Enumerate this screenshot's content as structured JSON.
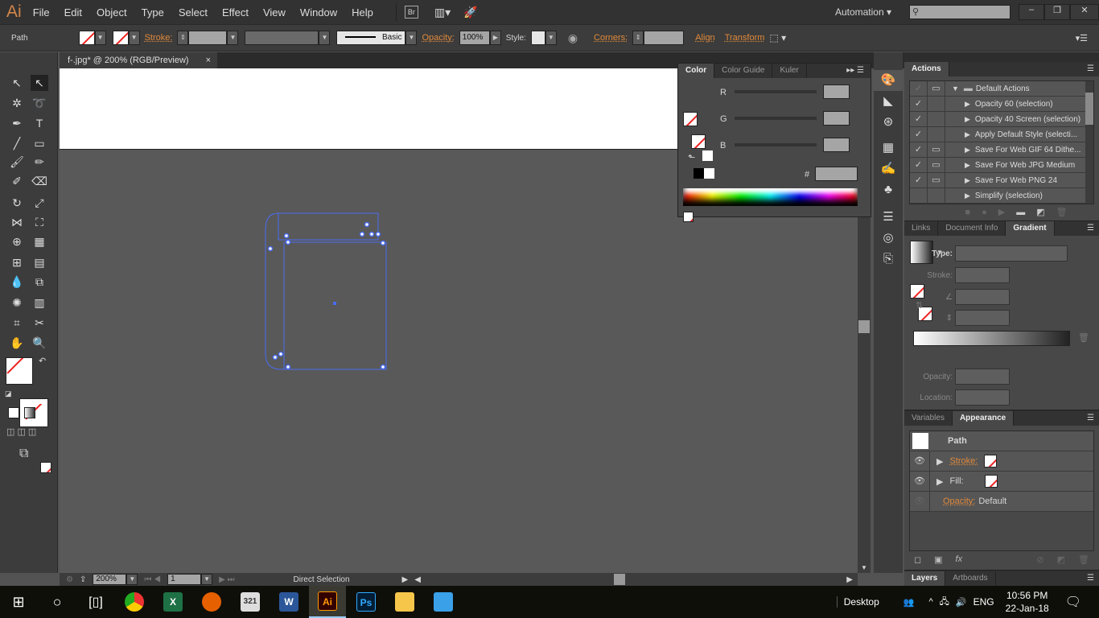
{
  "app": {
    "logo": "Ai"
  },
  "menu": [
    "File",
    "Edit",
    "Object",
    "Type",
    "Select",
    "Effect",
    "View",
    "Window",
    "Help"
  ],
  "bridge": "Br",
  "workspace": "Automation",
  "search": {
    "placeholder": ""
  },
  "control": {
    "selection": "Path",
    "stroke_label": "Stroke:",
    "brush": "Basic",
    "opacity_label": "Opacity:",
    "opacity": "100%",
    "style_label": "Style:",
    "corners_label": "Corners:",
    "align": "Align",
    "transform": "Transform"
  },
  "document": {
    "tab": "f-.jpg* @ 200% (RGB/Preview)",
    "close": "×"
  },
  "color_panel": {
    "tabs": [
      "Color",
      "Color Guide",
      "Kuler"
    ],
    "r": "R",
    "g": "G",
    "b": "B",
    "hash": "#"
  },
  "actions": {
    "tab": "Actions",
    "items": [
      {
        "label": "Default Actions",
        "folder": true
      },
      {
        "label": "Opacity 60 (selection)"
      },
      {
        "label": "Opacity 40 Screen (selection)"
      },
      {
        "label": "Apply Default Style (selecti..."
      },
      {
        "label": "Save For Web GIF 64 Dithe..."
      },
      {
        "label": "Save For Web JPG Medium"
      },
      {
        "label": "Save For Web PNG 24"
      },
      {
        "label": "Simplify (selection)"
      }
    ]
  },
  "gradient": {
    "tabs": [
      "Links",
      "Document Info",
      "Gradient"
    ],
    "type_label": "Type:",
    "stroke_label": "Stroke:",
    "opacity_label": "Opacity:",
    "location_label": "Location:"
  },
  "appearance": {
    "tabs": [
      "Variables",
      "Appearance"
    ],
    "title": "Path",
    "stroke": "Stroke:",
    "fill": "Fill:",
    "opacity": "Opacity:",
    "opacity_value": "Default",
    "fx": "fx"
  },
  "layers": {
    "tabs": [
      "Layers",
      "Artboards"
    ]
  },
  "status": {
    "zoom": "200%",
    "artboard": "1",
    "tool": "Direct Selection"
  },
  "taskbar": {
    "desktop": "Desktop",
    "lang": "ENG",
    "time": "10:56 PM",
    "date": "22-Jan-18",
    "apps": [
      "Chrome",
      "Excel",
      "Firefox",
      "Media Player",
      "Word",
      "Illustrator",
      "Photoshop",
      "File Explorer",
      "Network"
    ]
  }
}
